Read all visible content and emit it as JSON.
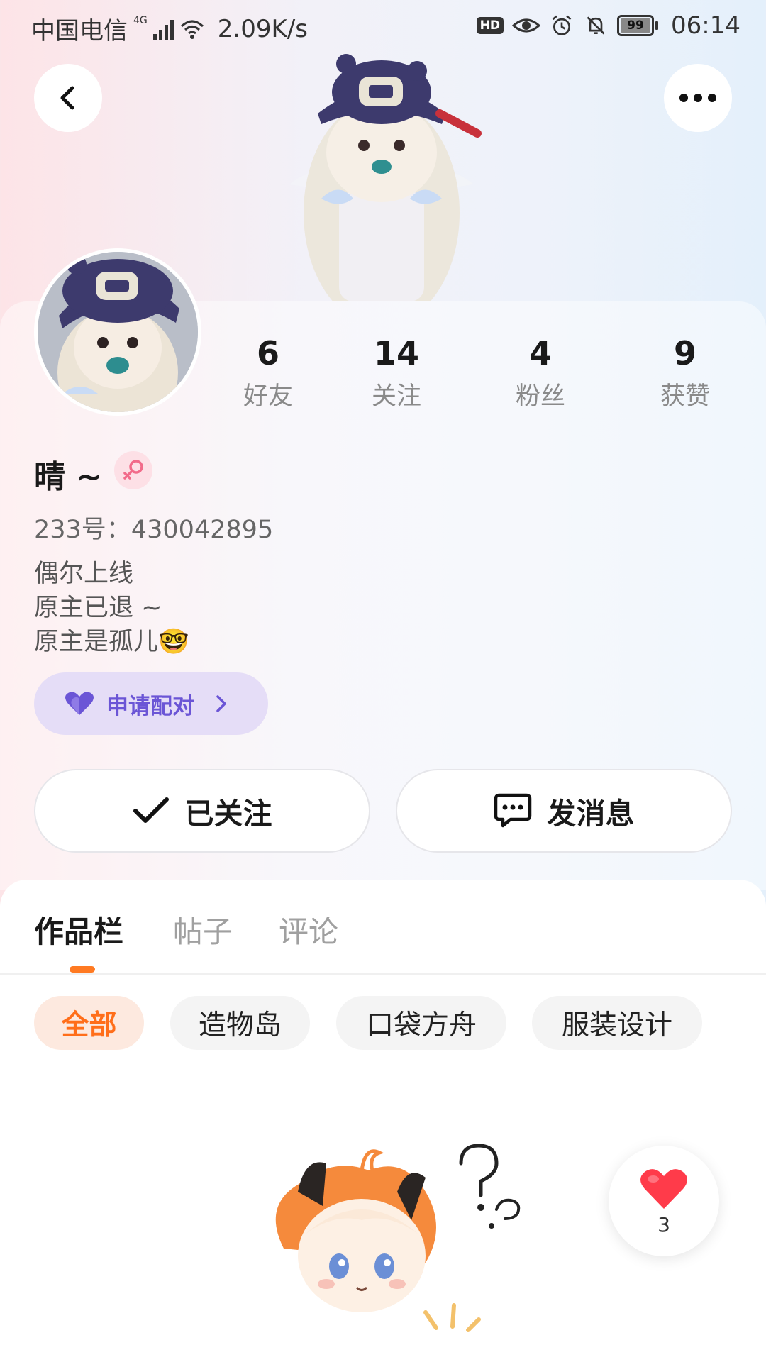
{
  "status_bar": {
    "carrier": "中国电信",
    "network": "4G",
    "speed": "2.09K/s",
    "battery": "99",
    "time": "06:14",
    "icons": [
      "signal-icon",
      "wifi-icon",
      "hd-icon",
      "eye-icon",
      "alarm-icon",
      "mute-bell-icon",
      "battery-icon"
    ]
  },
  "header": {
    "back_icon": "back-chevron-icon",
    "more_icon": "more-dots-icon"
  },
  "profile": {
    "name": "晴 ~",
    "gender": "female",
    "id_text": "233号：430042895",
    "bio": [
      "偶尔上线",
      "原主已退 ~",
      "原主是孤儿🤓"
    ],
    "stats": [
      {
        "value": "6",
        "label": "好友"
      },
      {
        "value": "14",
        "label": "关注"
      },
      {
        "value": "4",
        "label": "粉丝"
      },
      {
        "value": "9",
        "label": "获赞"
      }
    ],
    "pair_button": "申请配对",
    "follow_button": "已关注",
    "message_button": "发消息"
  },
  "tabs": [
    {
      "label": "作品栏",
      "active": true
    },
    {
      "label": "帖子",
      "active": false
    },
    {
      "label": "评论",
      "active": false
    }
  ],
  "chips": [
    {
      "label": "全部",
      "active": true
    },
    {
      "label": "造物岛",
      "active": false
    },
    {
      "label": "口袋方舟",
      "active": false
    },
    {
      "label": "服装设计",
      "active": false
    }
  ],
  "like": {
    "count": "3"
  },
  "colors": {
    "accent_orange": "#ff7a22",
    "pair_purple": "#6b55d6",
    "pair_bg": "#e5ddf7",
    "heart_red": "#ff3b4a"
  }
}
